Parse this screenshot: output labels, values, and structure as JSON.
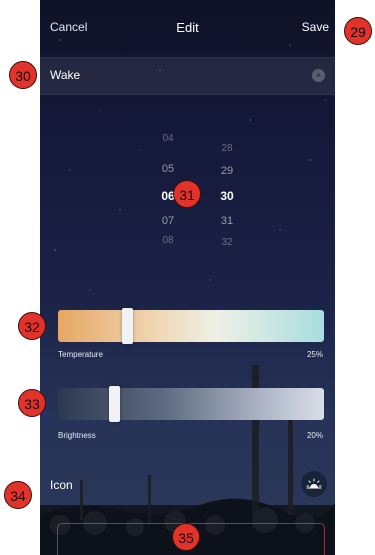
{
  "nav": {
    "cancel": "Cancel",
    "title": "Edit",
    "save": "Save"
  },
  "alarm": {
    "name": "Wake",
    "clear_icon": "×"
  },
  "time_picker": {
    "hours": [
      "04",
      "05",
      "06",
      "07",
      "08"
    ],
    "minutes": [
      "28",
      "29",
      "30",
      "31",
      "32"
    ],
    "selected_hour": "06",
    "selected_minute": "30"
  },
  "temperature": {
    "label": "Temperature",
    "value": "25%",
    "level": 0.25,
    "colors": [
      "#e6a764",
      "#a8dde0"
    ]
  },
  "brightness": {
    "label": "Brightness",
    "value": "20%",
    "level": 0.2
  },
  "icon_row": {
    "label": "Icon",
    "icon": "sunrise-icon"
  },
  "badges": [
    "29",
    "30",
    "31",
    "32",
    "33",
    "34",
    "35"
  ]
}
